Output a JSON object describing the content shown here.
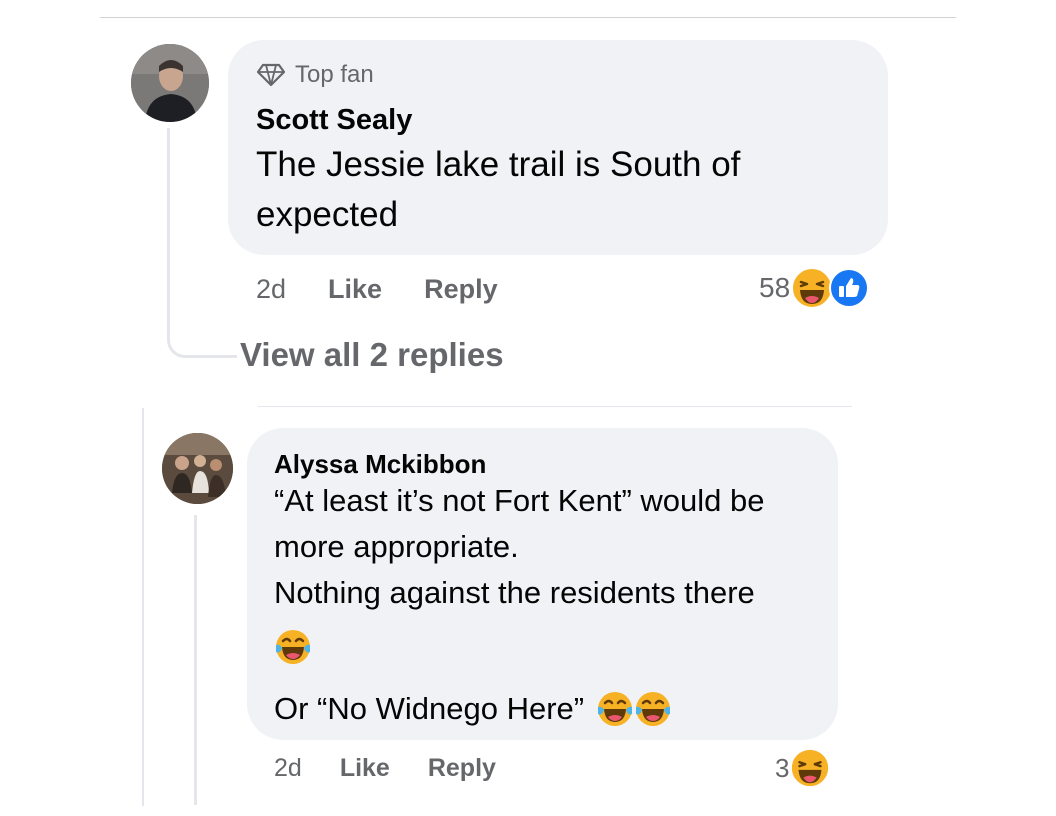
{
  "comment1": {
    "badge_label": "Top fan",
    "badge_icon": "diamond-icon",
    "author": "Scott Sealy",
    "text": "The Jessie lake trail is South of expected",
    "time": "2d",
    "like_label": "Like",
    "reply_label": "Reply",
    "reaction_count": "58",
    "reaction_icons": [
      "haha-reaction-icon",
      "like-reaction-icon"
    ]
  },
  "view_replies": "View all 2 replies",
  "comment2": {
    "author": "Alyssa Mckibbon",
    "lines": [
      "“At least it’s not Fort Kent” would be",
      "more appropriate.",
      "Nothing against the residents there"
    ],
    "last_line": "Or “No Widnego Here”",
    "time": "2d",
    "like_label": "Like",
    "reply_label": "Reply",
    "reaction_count": "3",
    "reaction_icons": [
      "haha-reaction-icon"
    ]
  },
  "colors": {
    "bubble": "#f0f2f5",
    "secondary_text": "#65676b",
    "like_blue": "#1877f2",
    "haha_yellow": "#f7b125"
  }
}
